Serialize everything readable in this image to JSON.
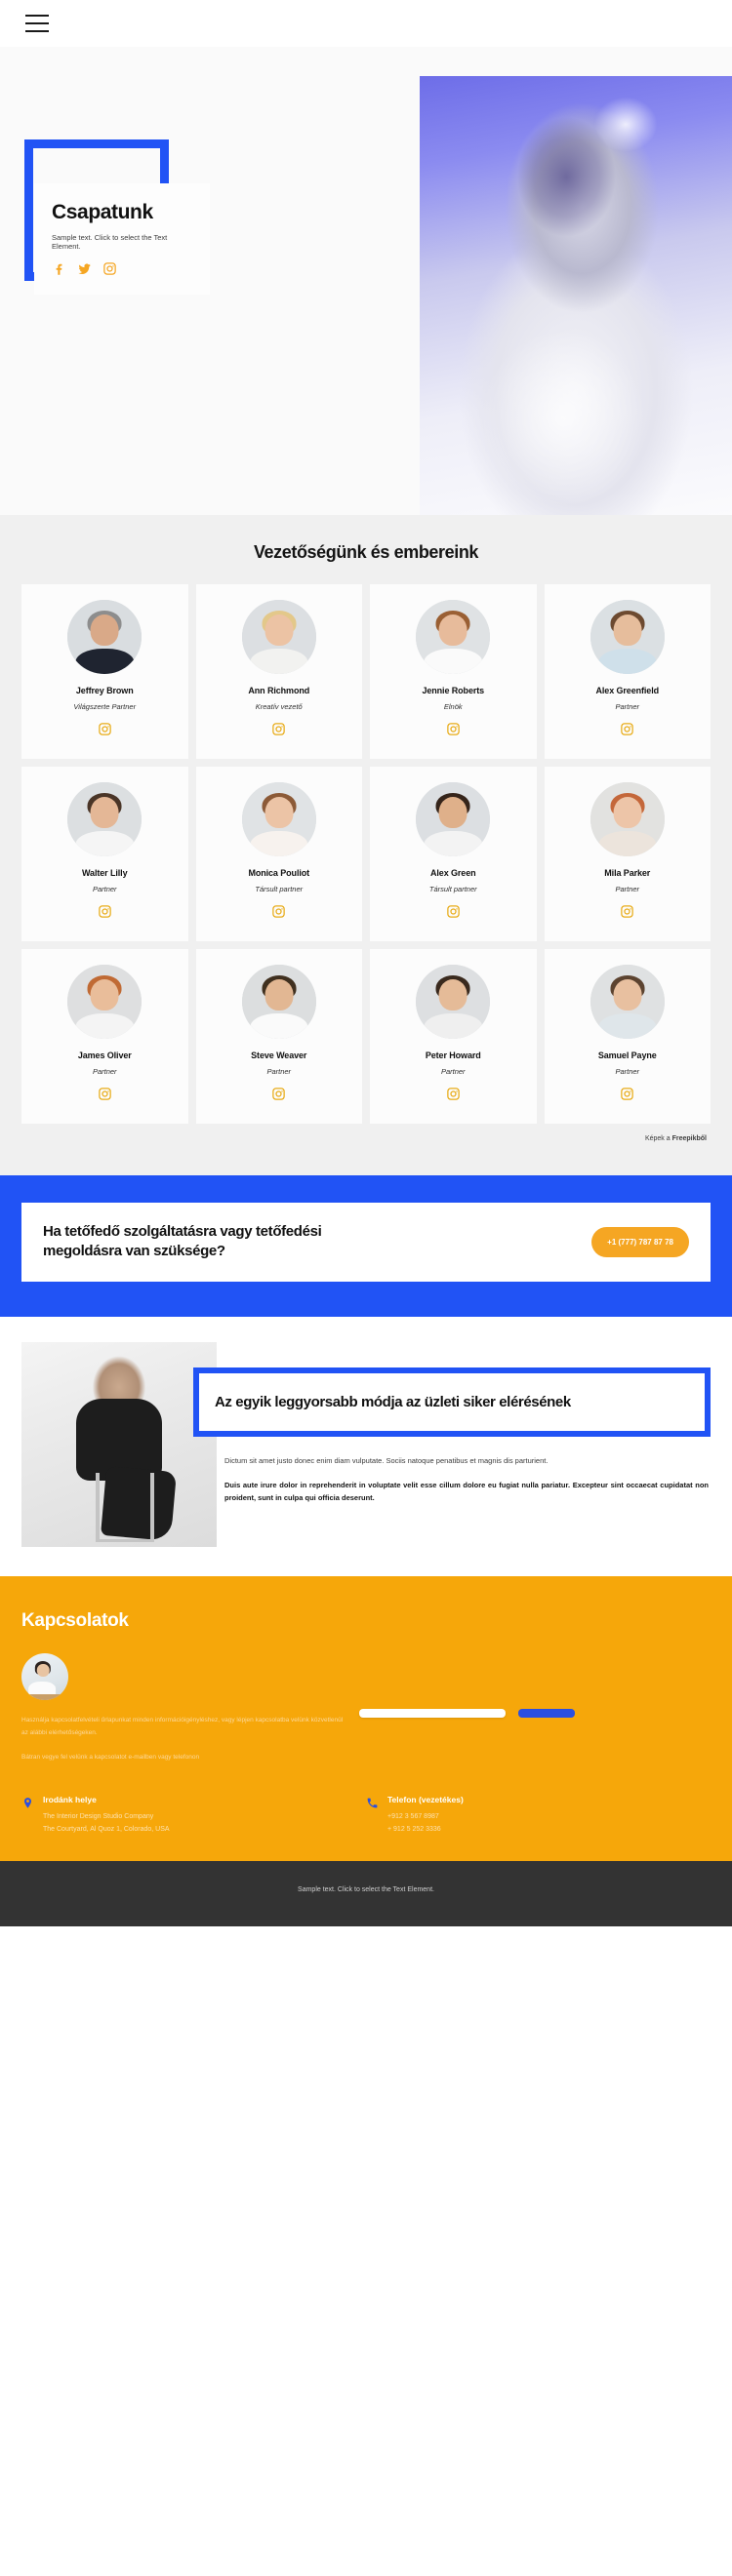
{
  "header": {
    "menu_icon": "hamburger-menu-icon"
  },
  "hero": {
    "title": "Csapatunk",
    "subtitle": "Sample text. Click to select the Text Element.",
    "social": [
      {
        "icon": "facebook-icon",
        "label": "Facebook"
      },
      {
        "icon": "twitter-icon",
        "label": "Twitter"
      },
      {
        "icon": "instagram-icon",
        "label": "Instagram"
      }
    ]
  },
  "team": {
    "heading": "Vezetőségünk és embereink",
    "credit_prefix": "Képek a ",
    "credit_source": "Freepikből",
    "members": [
      {
        "name": "Jeffrey Brown",
        "role": "Világszerte Partner",
        "social": "instagram-icon"
      },
      {
        "name": "Ann Richmond",
        "role": "Kreatív vezető",
        "social": "instagram-icon"
      },
      {
        "name": "Jennie Roberts",
        "role": "Elnök",
        "social": "instagram-icon"
      },
      {
        "name": "Alex Greenfield",
        "role": "Partner",
        "social": "instagram-icon"
      },
      {
        "name": "Walter Lilly",
        "role": "Partner",
        "social": "instagram-icon"
      },
      {
        "name": "Monica Pouliot",
        "role": "Társult partner",
        "social": "instagram-icon"
      },
      {
        "name": "Alex Green",
        "role": "Társult partner",
        "social": "instagram-icon"
      },
      {
        "name": "Mila Parker",
        "role": "Partner",
        "social": "instagram-icon"
      },
      {
        "name": "James Oliver",
        "role": "Partner",
        "social": "instagram-icon"
      },
      {
        "name": "Steve Weaver",
        "role": "Partner",
        "social": "instagram-icon"
      },
      {
        "name": "Peter Howard",
        "role": "Partner",
        "social": "instagram-icon"
      },
      {
        "name": "Samuel Payne",
        "role": "Partner",
        "social": "instagram-icon"
      }
    ]
  },
  "cta": {
    "text": "Ha tetőfedő szolgáltatásra vagy tetőfedési megoldásra van szüksége?",
    "button_label": "+1 (777) 787 87 78"
  },
  "feature": {
    "title": "Az egyik leggyorsabb módja az üzleti siker elérésének",
    "paragraph": "Dictum sit amet justo donec enim diam vulputate. Sociis natoque penatibus et magnis dis parturient.",
    "paragraph_bold": "Duis aute irure dolor in reprehenderit in voluptate velit esse cillum dolore eu fugiat nulla pariatur. Excepteur sint occaecat cupidatat non proident, sunt in culpa qui officia deserunt."
  },
  "contacts": {
    "heading": "Kapcsolatok",
    "paragraph_1": "Használja kapcsolatfelvételi űrlapunkat minden információigényléshez, vagy lépjen kapcsolatba velünk közvetlenül az alábbi elérhetőségeken.",
    "paragraph_2": "Bátran vegye fel velünk a kapcsolatot e-mailben vagy telefonon",
    "form": {
      "input_value": "",
      "input_placeholder": "",
      "send_label": ""
    },
    "office": {
      "icon": "location-pin-icon",
      "title": "Irodánk helye",
      "line_1": "The Interior Design Studio Company",
      "line_2": "The Courtyard, Al Quoz 1, Colorado, USA"
    },
    "phone": {
      "icon": "phone-icon",
      "title": "Telefon (vezetékes)",
      "line_1": "+912 3 567 8987",
      "line_2": "+ 912 5 252 3336"
    }
  },
  "footer": {
    "text": "Sample text. Click to select the Text Element."
  },
  "colors": {
    "blue": "#2153f5",
    "orange": "#f6a70a",
    "icon_orange": "#e8ab17",
    "dark": "#333333",
    "team_bg": "#f0f0f0"
  }
}
